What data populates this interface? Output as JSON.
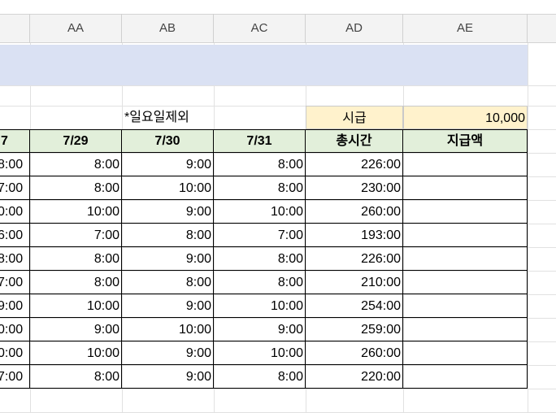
{
  "columns": [
    "AA",
    "AB",
    "AC",
    "AD",
    "AE"
  ],
  "note": "*일요일제외",
  "wage": {
    "label": "시급",
    "value": "10,000"
  },
  "headers": [
    "7",
    "7/29",
    "7/30",
    "7/31",
    "총시간",
    "지급액"
  ],
  "rows": [
    [
      "8:00",
      "8:00",
      "9:00",
      "8:00",
      "226:00",
      ""
    ],
    [
      "7:00",
      "8:00",
      "10:00",
      "8:00",
      "230:00",
      ""
    ],
    [
      "0:00",
      "10:00",
      "9:00",
      "10:00",
      "260:00",
      ""
    ],
    [
      "6:00",
      "7:00",
      "8:00",
      "7:00",
      "193:00",
      ""
    ],
    [
      "8:00",
      "8:00",
      "9:00",
      "8:00",
      "226:00",
      ""
    ],
    [
      "7:00",
      "8:00",
      "8:00",
      "8:00",
      "210:00",
      ""
    ],
    [
      "9:00",
      "10:00",
      "9:00",
      "10:00",
      "254:00",
      ""
    ],
    [
      "0:00",
      "9:00",
      "10:00",
      "9:00",
      "259:00",
      ""
    ],
    [
      "0:00",
      "10:00",
      "9:00",
      "10:00",
      "260:00",
      ""
    ],
    [
      "7:00",
      "8:00",
      "9:00",
      "8:00",
      "220:00",
      ""
    ]
  ]
}
